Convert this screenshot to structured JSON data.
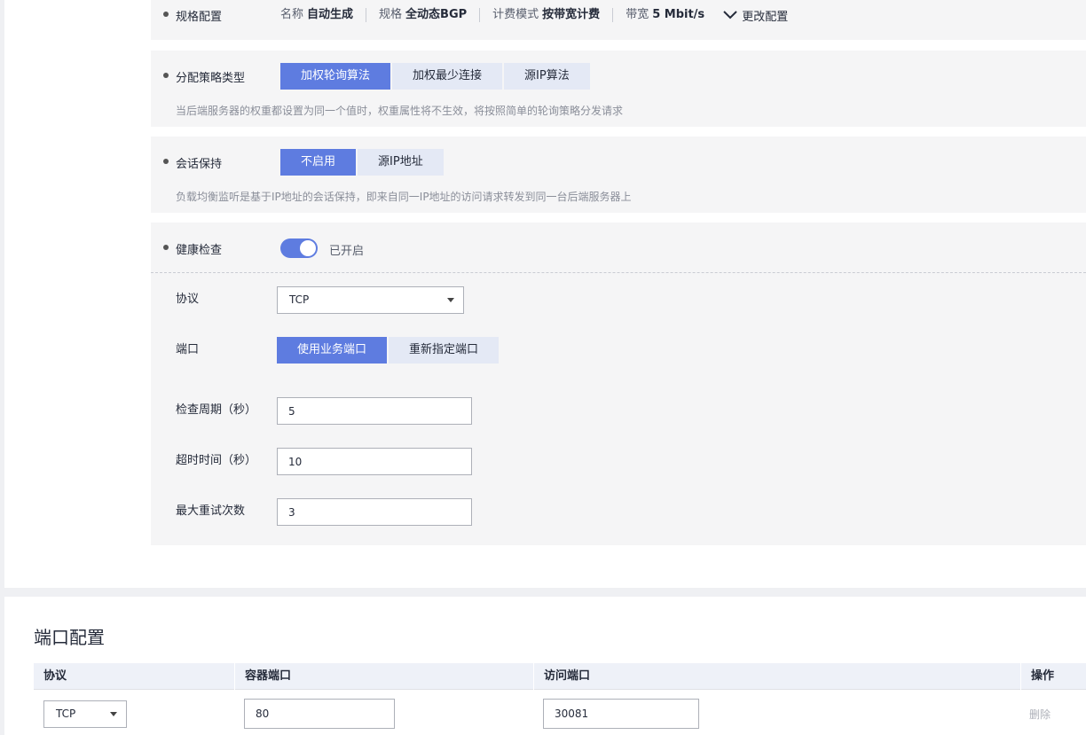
{
  "spec": {
    "label": "规格配置",
    "items": [
      {
        "key": "名称",
        "value": "自动生成"
      },
      {
        "key": "规格",
        "value": "全动态BGP"
      },
      {
        "key": "计费模式",
        "value": "按带宽计费"
      },
      {
        "key": "带宽",
        "value": "5 Mbit/s"
      }
    ],
    "change_label": "更改配置"
  },
  "distribution": {
    "label": "分配策略类型",
    "options": [
      "加权轮询算法",
      "加权最少连接",
      "源IP算法"
    ],
    "selected": "加权轮询算法",
    "hint": "当后端服务器的权重都设置为同一个值时，权重属性将不生效，将按照简单的轮询策略分发请求"
  },
  "session": {
    "label": "会话保持",
    "options": [
      "不启用",
      "源IP地址"
    ],
    "selected": "不启用",
    "hint": "负载均衡监听是基于IP地址的会话保持，即来自同一IP地址的访问请求转发到同一台后端服务器上"
  },
  "health": {
    "label": "健康检查",
    "enabled": true,
    "status_text": "已开启",
    "protocol_label": "协议",
    "protocol_value": "TCP",
    "port_label": "端口",
    "port_options": [
      "使用业务端口",
      "重新指定端口"
    ],
    "port_selected": "使用业务端口",
    "interval_label": "检查周期（秒）",
    "interval_value": "5",
    "timeout_label": "超时时间（秒）",
    "timeout_value": "10",
    "retries_label": "最大重试次数",
    "retries_value": "3"
  },
  "ports": {
    "title": "端口配置",
    "columns": [
      "协议",
      "容器端口",
      "访问端口",
      "操作"
    ],
    "rows": [
      {
        "protocol": "TCP",
        "container_port": "80",
        "access_port": "30081",
        "action": "删除"
      }
    ]
  },
  "colors": {
    "accent": "#5e7ce0",
    "panel_bg": "#f5f5f6",
    "option_bg": "#e4e9f5"
  }
}
